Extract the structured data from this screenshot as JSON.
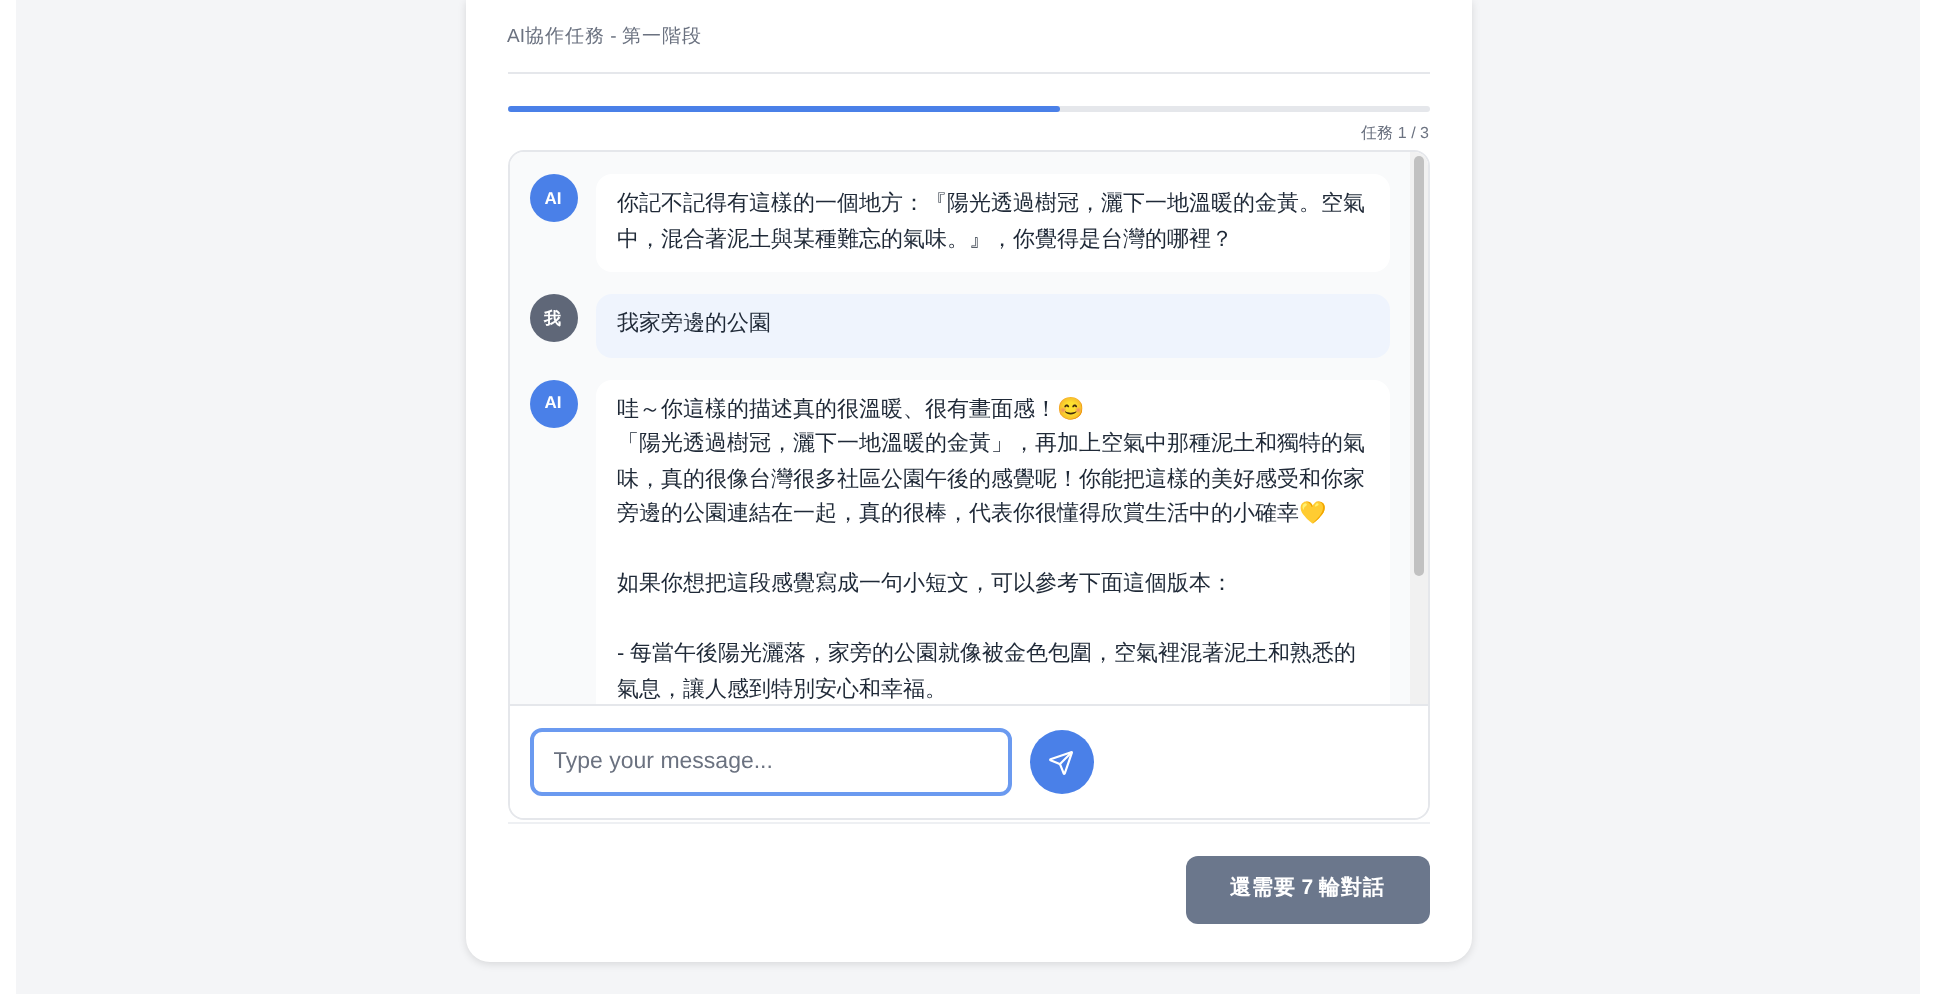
{
  "header": {
    "title": "AI協作任務 - 第一階段"
  },
  "progress": {
    "level": 0.6,
    "label": "任務 1 / 3"
  },
  "messages": [
    {
      "kind": "ai",
      "avatar": "AI",
      "paragraphs": [
        {
          "text": "你記不記得有這樣的一個地方：『陽光透過樹冠，灑下一地溫暖的金黃。空氣中，混合著泥土與某種難忘的氣味。』，你覺得是台灣的哪裡？",
          "gap_before": false
        }
      ]
    },
    {
      "kind": "user",
      "avatar": "我",
      "paragraphs": [
        {
          "text": "我家旁邊的公園",
          "gap_before": false
        }
      ]
    },
    {
      "kind": "ai",
      "avatar": "AI",
      "paragraphs": [
        {
          "text": "哇～你這樣的描述真的很溫暖、很有畫面感！😊",
          "gap_before": false
        },
        {
          "text": "「陽光透過樹冠，灑下一地溫暖的金黃」，再加上空氣中那種泥土和獨特的氣味，真的很像台灣很多社區公園午後的感覺呢！你能把這樣的美好感受和你家旁邊的公園連結在一起，真的很棒，代表你很懂得欣賞生活中的小確幸💛",
          "gap_before": false
        },
        {
          "text": "如果你想把這段感覺寫成一句小短文，可以參考下面這個版本：",
          "gap_before": true
        },
        {
          "text": "- 每當午後陽光灑落，家旁的公園就像被金色包圍，空氣裡混著泥土和熟悉的氣息，讓人感到特別安心和幸福。",
          "gap_before": true
        }
      ]
    }
  ],
  "composer": {
    "placeholder": "Type your message..."
  },
  "footer_button": {
    "label": "還需要 7 輪對話",
    "disabled": true
  }
}
